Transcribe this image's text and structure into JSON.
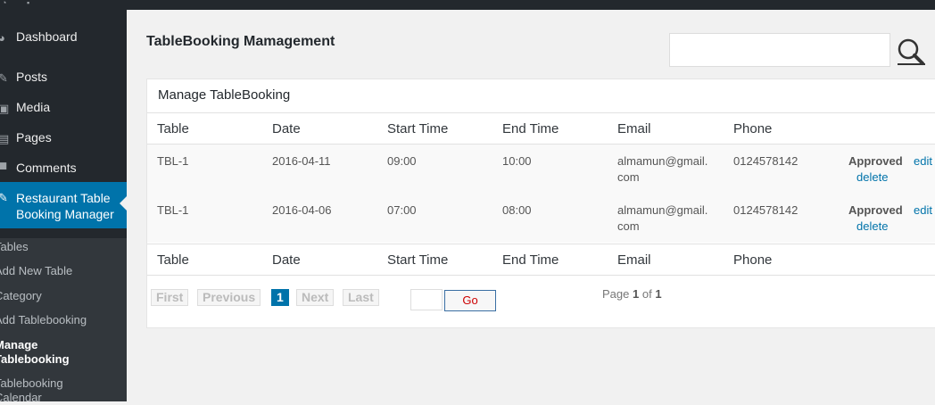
{
  "sidebar": {
    "menu": [
      {
        "label": "Dashboard",
        "icon": "dashboard-icon"
      },
      {
        "label": "Posts",
        "icon": "pin-icon"
      },
      {
        "label": "Media",
        "icon": "media-icon"
      },
      {
        "label": "Pages",
        "icon": "pages-icon"
      },
      {
        "label": "Comments",
        "icon": "comment-icon"
      },
      {
        "label": "Restaurant Table Booking Manager",
        "icon": "pin-icon"
      }
    ],
    "submenu": [
      "Tables",
      "Add New Table",
      "Category",
      "Add Tablebooking",
      "Manage Tablebooking",
      "Tablebooking Calendar"
    ]
  },
  "page": {
    "title": "TableBooking Mamagement",
    "search_placeholder": ""
  },
  "table": {
    "title": "Manage TableBooking",
    "columns": [
      "Table",
      "Date",
      "Start Time",
      "End Time",
      "Email",
      "Phone"
    ],
    "rows": [
      {
        "table": "TBL-1",
        "date": "2016-04-11",
        "start": "09:00",
        "end": "10:00",
        "email_line1": "almamun@gmail.",
        "email_line2": "com",
        "phone": "0124578142",
        "status": "Approved",
        "edit": "edit",
        "delete": "delete"
      },
      {
        "table": "TBL-1",
        "date": "2016-04-06",
        "start": "07:00",
        "end": "08:00",
        "email_line1": "almamun@gmail.",
        "email_line2": "com",
        "phone": "0124578142",
        "status": "Approved",
        "edit": "edit",
        "delete": "delete"
      }
    ]
  },
  "pagination": {
    "first": "First",
    "previous": "Previous",
    "current": "1",
    "next": "Next",
    "last": "Last",
    "go": "Go",
    "page_prefix": "Page",
    "page_num": "1",
    "of": "of",
    "total": "1"
  },
  "colors": {
    "accent": "#0073aa",
    "sidebar": "#23282d",
    "submenu": "#32373c"
  }
}
